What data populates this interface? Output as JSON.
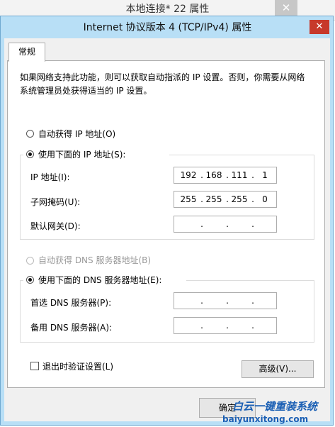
{
  "bg_window": {
    "title": "本地连接* 22 属性",
    "close_glyph": "✕"
  },
  "dialog": {
    "title": "Internet 协议版本 4 (TCP/IPv4) 属性",
    "close_glyph": "✕"
  },
  "tab": {
    "label": "常规"
  },
  "description": "如果网络支持此功能，则可以获取自动指派的 IP 设置。否则，你需要从网络系统管理员处获得适当的 IP 设置。",
  "ip": {
    "auto_label": "自动获得 IP 地址(O)",
    "manual_label": "使用下面的 IP 地址(S):",
    "address_label": "IP 地址(I):",
    "address": [
      "192",
      "168",
      "111",
      "1"
    ],
    "mask_label": "子网掩码(U):",
    "mask": [
      "255",
      "255",
      "255",
      "0"
    ],
    "gateway_label": "默认网关(D):",
    "gateway": [
      "",
      "",
      "",
      ""
    ]
  },
  "dns": {
    "auto_label": "自动获得 DNS 服务器地址(B)",
    "manual_label": "使用下面的 DNS 服务器地址(E):",
    "preferred_label": "首选 DNS 服务器(P):",
    "preferred": [
      "",
      "",
      "",
      ""
    ],
    "alternate_label": "备用 DNS 服务器(A):",
    "alternate": [
      "",
      "",
      "",
      ""
    ]
  },
  "validate_label": "退出时验证设置(L)",
  "advanced_label": "高级(V)...",
  "ok_label": "确定",
  "watermark": {
    "line1": "白云一键重装系统",
    "line2": "baiyunxitong.com"
  },
  "colors": {
    "title_bar": "#b8dff6",
    "close_red": "#c7392b",
    "watermark": "#1a5fb4"
  }
}
